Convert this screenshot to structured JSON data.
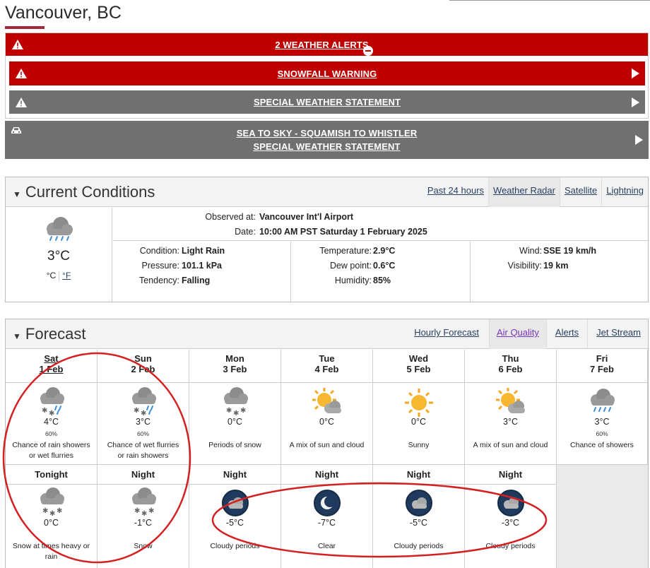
{
  "city": "Vancouver, BC",
  "alerts": {
    "summary": "2 WEATHER ALERTS",
    "snowfall": "SNOWFALL WARNING",
    "special": "SPECIAL WEATHER STATEMENT",
    "highway_line1": "SEA TO SKY - SQUAMISH TO WHISTLER",
    "highway_line2": "SPECIAL WEATHER STATEMENT",
    "colors": {
      "warning": "#c00000",
      "statement": "#707070"
    }
  },
  "current": {
    "title": "Current Conditions",
    "links": [
      "Past 24 hours",
      "Weather Radar",
      "Satellite",
      "Lightning"
    ],
    "icon": "rain-cloud-icon",
    "temp": "3°C",
    "unit_c": "°C",
    "unit_f": "°F",
    "observed_label": "Observed at:",
    "observed_value": "Vancouver Int'l Airport",
    "date_label": "Date:",
    "date_value": "10:00 AM PST Saturday 1 February 2025",
    "condition_label": "Condition:",
    "condition_value": "Light Rain",
    "pressure_label": "Pressure:",
    "pressure_value": "101.1 kPa",
    "tendency_label": "Tendency:",
    "tendency_value": "Falling",
    "temperature_label": "Temperature:",
    "temperature_value": "2.9°C",
    "dewpoint_label": "Dew point:",
    "dewpoint_value": "0.6°C",
    "humidity_label": "Humidity:",
    "humidity_value": "85%",
    "wind_label": "Wind:",
    "wind_value": "SSE 19 km/h",
    "visibility_label": "Visibility:",
    "visibility_value": "19 km"
  },
  "forecast": {
    "title": "Forecast",
    "links": [
      "Hourly Forecast",
      "Air Quality",
      "Alerts",
      "Jet Stream"
    ],
    "days": [
      {
        "name": "Sat",
        "date": "1 Feb",
        "icon": "rain-snow-icon",
        "temp": "4°C",
        "pop": "60%",
        "summary": [
          "Chance of rain showers",
          "or wet flurries"
        ]
      },
      {
        "name": "Sun",
        "date": "2 Feb",
        "icon": "rain-snow-icon",
        "temp": "3°C",
        "pop": "60%",
        "summary": [
          "Chance of wet flurries",
          "or rain showers"
        ]
      },
      {
        "name": "Mon",
        "date": "3 Feb",
        "icon": "snow-cloud-icon",
        "temp": "0°C",
        "pop": "",
        "summary": [
          "Periods of snow",
          ""
        ]
      },
      {
        "name": "Tue",
        "date": "4 Feb",
        "icon": "sun-cloud-icon",
        "temp": "0°C",
        "pop": "",
        "summary": [
          "A mix of sun and cloud",
          ""
        ]
      },
      {
        "name": "Wed",
        "date": "5 Feb",
        "icon": "sun-icon",
        "temp": "0°C",
        "pop": "",
        "summary": [
          "Sunny",
          ""
        ]
      },
      {
        "name": "Thu",
        "date": "6 Feb",
        "icon": "sun-cloud-icon",
        "temp": "3°C",
        "pop": "",
        "summary": [
          "A mix of sun and cloud",
          ""
        ]
      },
      {
        "name": "Fri",
        "date": "7 Feb",
        "icon": "rain-cloud-icon",
        "temp": "3°C",
        "pop": "60%",
        "summary": [
          "Chance of showers",
          ""
        ]
      }
    ],
    "nights": [
      {
        "name": "Tonight",
        "icon": "snow-cloud-icon",
        "temp": "0°C",
        "summary": [
          "Snow at times heavy or",
          "rain"
        ]
      },
      {
        "name": "Night",
        "icon": "snow-cloud-icon",
        "temp": "-1°C",
        "summary": [
          "Snow",
          ""
        ]
      },
      {
        "name": "Night",
        "icon": "moon-cloud-icon",
        "temp": "-5°C",
        "summary": [
          "Cloudy periods",
          ""
        ]
      },
      {
        "name": "Night",
        "icon": "moon-icon",
        "temp": "-7°C",
        "summary": [
          "Clear",
          ""
        ]
      },
      {
        "name": "Night",
        "icon": "moon-cloud-icon",
        "temp": "-5°C",
        "summary": [
          "Cloudy periods",
          ""
        ]
      },
      {
        "name": "Night",
        "icon": "moon-cloud-icon",
        "temp": "-3°C",
        "summary": [
          "Cloudy periods",
          ""
        ]
      }
    ]
  },
  "annotation_color": "#d42020"
}
